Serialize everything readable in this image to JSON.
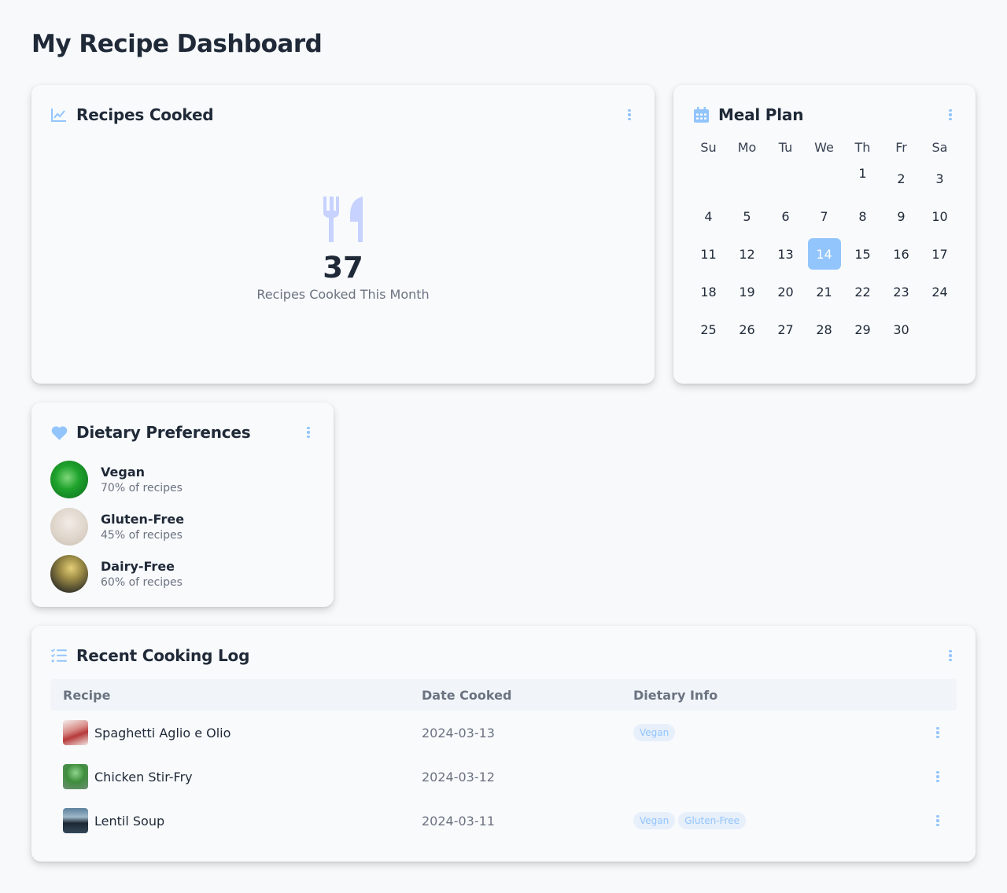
{
  "page": {
    "title": "My Recipe Dashboard"
  },
  "colors": {
    "accent": "#93c5fd",
    "text": "#1f2937",
    "muted": "#6b7280",
    "icon_fill": "#c7d2fe"
  },
  "cooked": {
    "title": "Recipes Cooked",
    "icon": "chart-line-icon",
    "count": "37",
    "label": "Recipes Cooked This Month"
  },
  "meal_plan": {
    "title": "Meal Plan",
    "icon": "calendar-icon",
    "weekdays": [
      "Su",
      "Mo",
      "Tu",
      "We",
      "Th",
      "Fr",
      "Sa"
    ],
    "first_weekday_index": 4,
    "days_in_month": 30,
    "selected_day": 14
  },
  "dietary": {
    "title": "Dietary Preferences",
    "icon": "heart-icon",
    "items": [
      {
        "name": "Vegan",
        "pct": "70% of recipes",
        "image": "green-leaf"
      },
      {
        "name": "Gluten-Free",
        "pct": "45% of recipes",
        "image": "white-flour"
      },
      {
        "name": "Dairy-Free",
        "pct": "60% of recipes",
        "image": "yellow-leaf"
      }
    ]
  },
  "log": {
    "title": "Recent Cooking Log",
    "icon": "list-check-icon",
    "columns": {
      "recipe": "Recipe",
      "date": "Date Cooked",
      "diet": "Dietary Info"
    },
    "rows": [
      {
        "recipe": "Spaghetti Aglio e Olio",
        "date": "2024-03-13",
        "tags": [
          "Vegan"
        ]
      },
      {
        "recipe": "Chicken Stir-Fry",
        "date": "2024-03-12",
        "tags": []
      },
      {
        "recipe": "Lentil Soup",
        "date": "2024-03-11",
        "tags": [
          "Vegan",
          "Gluten-Free"
        ]
      }
    ]
  }
}
